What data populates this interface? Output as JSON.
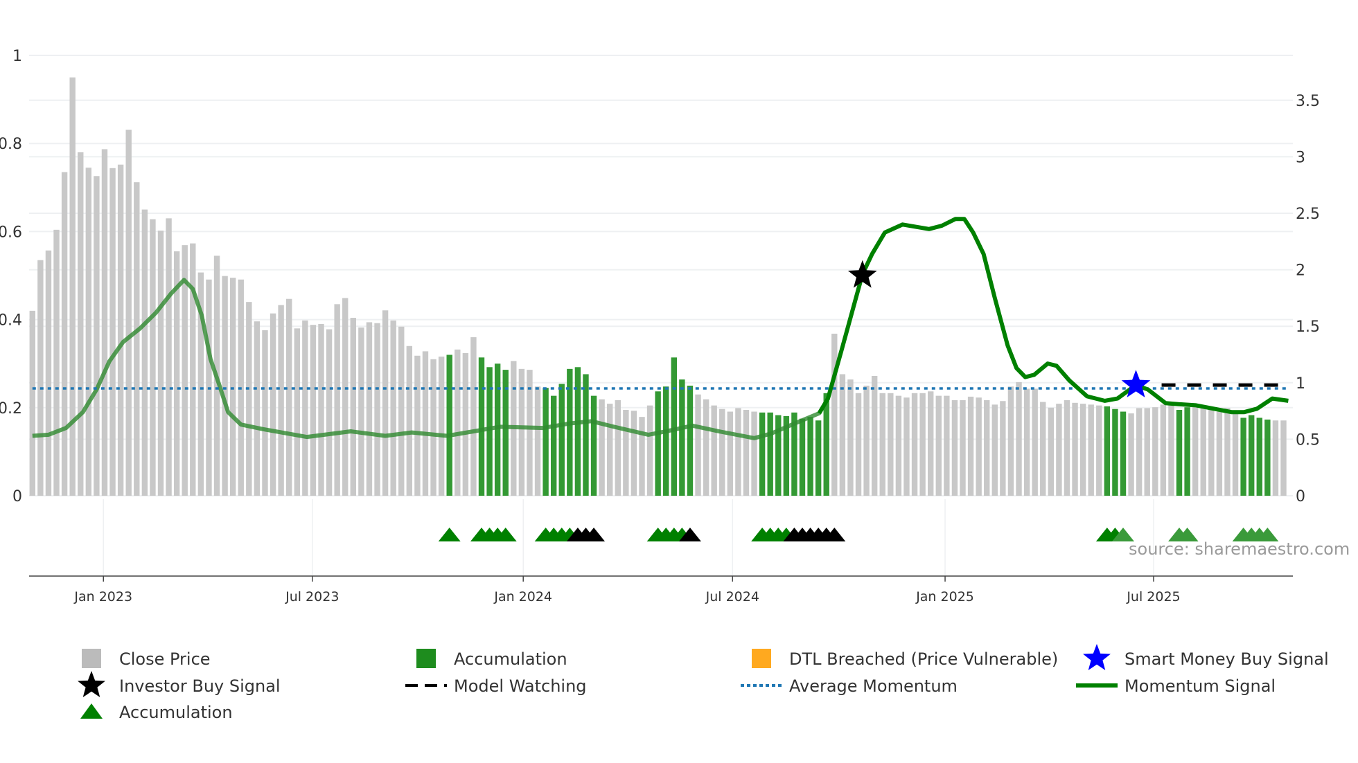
{
  "chart_data": {
    "type": "bar",
    "title": "",
    "source": "source: sharemaestro.com",
    "x_unit": "week index (weekly bars, ~Nov 2022 to Oct 2025)",
    "x_ticks": [
      {
        "week": 8.85,
        "label": "Jan 2023"
      },
      {
        "week": 34.9,
        "label": "Jul 2023"
      },
      {
        "week": 61.2,
        "label": "Jan 2024"
      },
      {
        "week": 87.3,
        "label": "Jul 2024"
      },
      {
        "week": 113.8,
        "label": "Jan 2025"
      },
      {
        "week": 139.8,
        "label": "Jul 2025"
      }
    ],
    "y_left": {
      "range": [
        0,
        1
      ],
      "ticks": [
        "0",
        "0.2",
        "0.4",
        "0.6",
        "0.8",
        "1"
      ],
      "tick_values": [
        0,
        0.2,
        0.4,
        0.6,
        0.8,
        1
      ]
    },
    "y_right": {
      "range": [
        0,
        3.9
      ],
      "ticks": [
        "0",
        "0.5",
        "1",
        "1.5",
        "2",
        "2.5",
        "3",
        "3.5"
      ],
      "tick_values": [
        0,
        0.5,
        1,
        1.5,
        2,
        2.5,
        3,
        3.5
      ]
    },
    "close_price": [
      0.42,
      0.535,
      0.557,
      0.604,
      0.735,
      0.95,
      0.78,
      0.745,
      0.726,
      0.787,
      0.744,
      0.752,
      0.831,
      0.712,
      0.65,
      0.628,
      0.602,
      0.63,
      0.555,
      0.569,
      0.573,
      0.507,
      0.491,
      0.545,
      0.499,
      0.495,
      0.491,
      0.44,
      0.396,
      0.376,
      0.414,
      0.433,
      0.447,
      0.38,
      0.398,
      0.388,
      0.39,
      0.378,
      0.435,
      0.449,
      0.404,
      0.382,
      0.394,
      0.392,
      0.421,
      0.398,
      0.384,
      0.34,
      0.318,
      0.328,
      0.31,
      0.316,
      0.32,
      0.332,
      0.324,
      0.36,
      0.314,
      0.292,
      0.3,
      0.286,
      0.306,
      0.288,
      0.286,
      0.248,
      0.245,
      0.227,
      0.254,
      0.288,
      0.292,
      0.276,
      0.227,
      0.219,
      0.209,
      0.217,
      0.195,
      0.193,
      0.179,
      0.205,
      0.237,
      0.248,
      0.314,
      0.264,
      0.25,
      0.23,
      0.219,
      0.205,
      0.197,
      0.191,
      0.199,
      0.195,
      0.191,
      0.189,
      0.189,
      0.183,
      0.181,
      0.189,
      0.175,
      0.179,
      0.171,
      0.233,
      0.368,
      0.276,
      0.264,
      0.233,
      0.25,
      0.272,
      0.233,
      0.233,
      0.227,
      0.223,
      0.233,
      0.233,
      0.237,
      0.227,
      0.227,
      0.217,
      0.217,
      0.225,
      0.223,
      0.217,
      0.207,
      0.215,
      0.248,
      0.258,
      0.243,
      0.243,
      0.213,
      0.2,
      0.209,
      0.217,
      0.211,
      0.209,
      0.207,
      0.205,
      0.203,
      0.197,
      0.191,
      0.187,
      0.199,
      0.199,
      0.201,
      0.207,
      0.211,
      0.195,
      0.201,
      0.207,
      0.205,
      0.195,
      0.191,
      0.199,
      0.191,
      0.177,
      0.183,
      0.177,
      0.173,
      0.171,
      0.171
    ],
    "accumulation_weeks": [
      52,
      56,
      57,
      58,
      59,
      64,
      65,
      66,
      67,
      68,
      69,
      70,
      78,
      79,
      80,
      81,
      82,
      91,
      92,
      93,
      94,
      95,
      96,
      97,
      98,
      99,
      134,
      135,
      136,
      143,
      144,
      151,
      152,
      153,
      154
    ],
    "momentum_signal": [
      [
        0,
        0.53
      ],
      [
        2,
        0.54
      ],
      [
        4.2,
        0.6
      ],
      [
        6.3,
        0.74
      ],
      [
        8,
        0.94
      ],
      [
        9.6,
        1.19
      ],
      [
        11.3,
        1.36
      ],
      [
        13.4,
        1.48
      ],
      [
        15.4,
        1.62
      ],
      [
        17.3,
        1.79
      ],
      [
        18.9,
        1.91
      ],
      [
        20,
        1.83
      ],
      [
        21.1,
        1.6
      ],
      [
        22.2,
        1.21
      ],
      [
        23.3,
        0.98
      ],
      [
        24.4,
        0.74
      ],
      [
        26,
        0.63
      ],
      [
        28.7,
        0.59
      ],
      [
        34.2,
        0.52
      ],
      [
        39.7,
        0.57
      ],
      [
        44,
        0.53
      ],
      [
        47.3,
        0.56
      ],
      [
        51.7,
        0.53
      ],
      [
        55,
        0.57
      ],
      [
        58.3,
        0.61
      ],
      [
        63.7,
        0.6
      ],
      [
        67,
        0.64
      ],
      [
        69.7,
        0.66
      ],
      [
        72.5,
        0.61
      ],
      [
        76.8,
        0.54
      ],
      [
        79,
        0.57
      ],
      [
        82.3,
        0.62
      ],
      [
        85.6,
        0.57
      ],
      [
        90,
        0.51
      ],
      [
        92.1,
        0.55
      ],
      [
        95.4,
        0.65
      ],
      [
        98.1,
        0.73
      ],
      [
        99.2,
        0.86
      ],
      [
        100.9,
        1.29
      ],
      [
        103.5,
        1.96
      ],
      [
        104.7,
        2.14
      ],
      [
        106.3,
        2.33
      ],
      [
        108.5,
        2.4
      ],
      [
        111.8,
        2.36
      ],
      [
        113.4,
        2.39
      ],
      [
        115.1,
        2.45
      ],
      [
        116.2,
        2.45
      ],
      [
        117.3,
        2.33
      ],
      [
        118.6,
        2.14
      ],
      [
        120,
        1.75
      ],
      [
        121.6,
        1.33
      ],
      [
        122.7,
        1.13
      ],
      [
        123.8,
        1.05
      ],
      [
        124.9,
        1.07
      ],
      [
        126.6,
        1.17
      ],
      [
        127.7,
        1.15
      ],
      [
        129.3,
        1.02
      ],
      [
        131.5,
        0.88
      ],
      [
        133.7,
        0.84
      ],
      [
        135.3,
        0.86
      ],
      [
        137.6,
        0.98
      ],
      [
        139.1,
        0.94
      ],
      [
        141.3,
        0.82
      ],
      [
        142.9,
        0.81
      ],
      [
        145.1,
        0.8
      ],
      [
        147.3,
        0.77
      ],
      [
        149.5,
        0.74
      ],
      [
        151.1,
        0.74
      ],
      [
        152.7,
        0.77
      ],
      [
        154.6,
        0.86
      ],
      [
        156.6,
        0.84
      ]
    ],
    "momentum_bright_from_week": 99,
    "average_momentum": 0.95,
    "model_watching": {
      "from_week": 140.8,
      "to_week": 156.6,
      "value": 0.98
    },
    "investor_buy_signal": [
      {
        "week": 103.5,
        "value": 1.95
      }
    ],
    "smart_money_buy_signal": [
      {
        "week": 137.6,
        "value": 0.98
      }
    ],
    "accumulation_markers": [
      {
        "week": 52,
        "color": "green"
      },
      {
        "week": 56,
        "color": "green"
      },
      {
        "week": 57,
        "color": "green"
      },
      {
        "week": 58,
        "color": "green"
      },
      {
        "week": 59,
        "color": "green"
      },
      {
        "week": 64,
        "color": "green"
      },
      {
        "week": 65,
        "color": "green"
      },
      {
        "week": 66,
        "color": "green"
      },
      {
        "week": 67,
        "color": "green"
      },
      {
        "week": 68,
        "color": "black"
      },
      {
        "week": 69,
        "color": "black"
      },
      {
        "week": 70,
        "color": "black"
      },
      {
        "week": 78,
        "color": "green"
      },
      {
        "week": 79,
        "color": "green"
      },
      {
        "week": 80,
        "color": "green"
      },
      {
        "week": 81,
        "color": "green"
      },
      {
        "week": 82,
        "color": "black"
      },
      {
        "week": 91,
        "color": "green"
      },
      {
        "week": 92,
        "color": "green"
      },
      {
        "week": 93,
        "color": "green"
      },
      {
        "week": 94,
        "color": "green"
      },
      {
        "week": 95,
        "color": "black"
      },
      {
        "week": 96,
        "color": "black"
      },
      {
        "week": 97,
        "color": "black"
      },
      {
        "week": 98,
        "color": "black"
      },
      {
        "week": 99,
        "color": "black"
      },
      {
        "week": 100,
        "color": "black"
      },
      {
        "week": 134,
        "color": "green"
      },
      {
        "week": 135,
        "color": "green"
      },
      {
        "week": 136,
        "color": "light"
      },
      {
        "week": 143,
        "color": "light"
      },
      {
        "week": 144,
        "color": "light"
      },
      {
        "week": 151,
        "color": "light"
      },
      {
        "week": 152,
        "color": "light"
      },
      {
        "week": 153,
        "color": "light"
      },
      {
        "week": 154,
        "color": "light"
      }
    ],
    "legend": [
      {
        "key": "close",
        "label": "Close Price"
      },
      {
        "key": "accum_bar",
        "label": "Accumulation"
      },
      {
        "key": "dtl",
        "label": "DTL Breached (Price Vulnerable)"
      },
      {
        "key": "smart",
        "label": "Smart Money Buy Signal"
      },
      {
        "key": "investor",
        "label": "Investor Buy Signal"
      },
      {
        "key": "watch",
        "label": "Model Watching"
      },
      {
        "key": "avg",
        "label": "Average Momentum"
      },
      {
        "key": "momentum",
        "label": "Momentum Signal"
      },
      {
        "key": "accum_tri",
        "label": "Accumulation"
      }
    ],
    "legend_placement": "bottom",
    "grid": true
  },
  "colors": {
    "close": "#c8c8c8",
    "accumulation": "#339933",
    "momentum": "#008000",
    "avg": "#1f77b4",
    "dtl": "#ffa91f",
    "smart": "#0000ff",
    "investor": "#000000",
    "tri_light": "#3a9a3a"
  }
}
